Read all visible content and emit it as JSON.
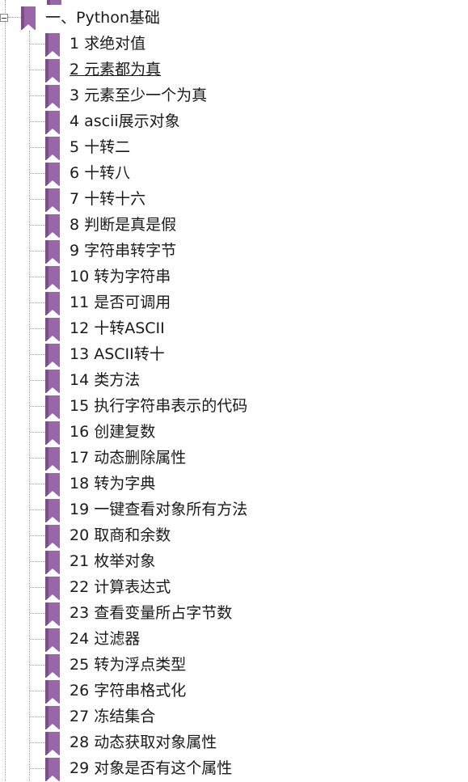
{
  "tree": {
    "root": {
      "label": "一、Python基础",
      "icon": "bookmark-icon",
      "expanded": true
    },
    "items": [
      {
        "label": "1 求绝对值"
      },
      {
        "label": "2 元素都为真",
        "underlined": true
      },
      {
        "label": "3 元素至少一个为真"
      },
      {
        "label": "4 ascii展示对象"
      },
      {
        "label": "5  十转二"
      },
      {
        "label": "6 十转八"
      },
      {
        "label": "7 十转十六"
      },
      {
        "label": "8 判断是真是假"
      },
      {
        "label": "9  字符串转字节"
      },
      {
        "label": "10 转为字符串"
      },
      {
        "label": "11 是否可调用"
      },
      {
        "label": "12 十转ASCII"
      },
      {
        "label": "13 ASCII转十"
      },
      {
        "label": "14 类方法"
      },
      {
        "label": "15 执行字符串表示的代码"
      },
      {
        "label": "16  创建复数"
      },
      {
        "label": "17 动态删除属性"
      },
      {
        "label": "18 转为字典"
      },
      {
        "label": "19 一键查看对象所有方法"
      },
      {
        "label": "20 取商和余数"
      },
      {
        "label": "21 枚举对象"
      },
      {
        "label": "22 计算表达式"
      },
      {
        "label": "23 查看变量所占字节数"
      },
      {
        "label": "24 过滤器"
      },
      {
        "label": "25 转为浮点类型"
      },
      {
        "label": "26 字符串格式化"
      },
      {
        "label": "27 冻结集合"
      },
      {
        "label": "28 动态获取对象属性"
      },
      {
        "label": "29 对象是否有这个属性"
      }
    ]
  },
  "colors": {
    "bookmark": "#9966a8",
    "bookmark_dark": "#7a4f87",
    "connector": "#9a9a9a",
    "text": "#1a1a1a"
  }
}
